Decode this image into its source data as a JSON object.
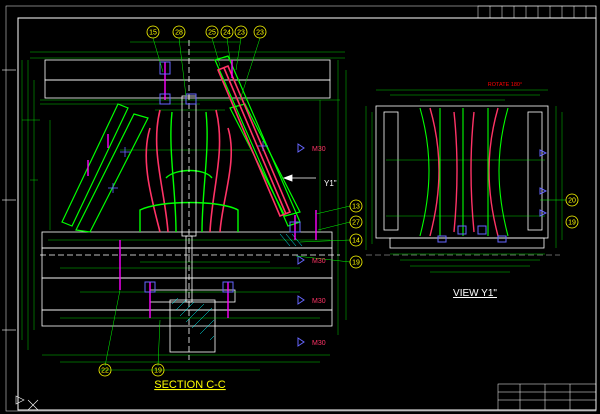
{
  "drawing": {
    "section_title": "SECTION C-C",
    "view_title": "VIEW Y1\"",
    "view_marker": "Y1\"",
    "balloons": [
      "15",
      "28",
      "25",
      "24",
      "23",
      "23",
      "13",
      "27",
      "14",
      "19",
      "22",
      "19",
      "20",
      "19"
    ],
    "metric_labels": [
      "M30",
      "M30",
      "M30",
      "M30"
    ],
    "red_note": "ROTATE 180°",
    "colors": {
      "background": "#000000",
      "outline": "#ffffff",
      "dimension": "#00ff00",
      "insert": "#ff00ff",
      "core": "#ff3366",
      "pin": "#6666ff",
      "label": "#ffff00",
      "hatch": "#00ffff"
    }
  }
}
